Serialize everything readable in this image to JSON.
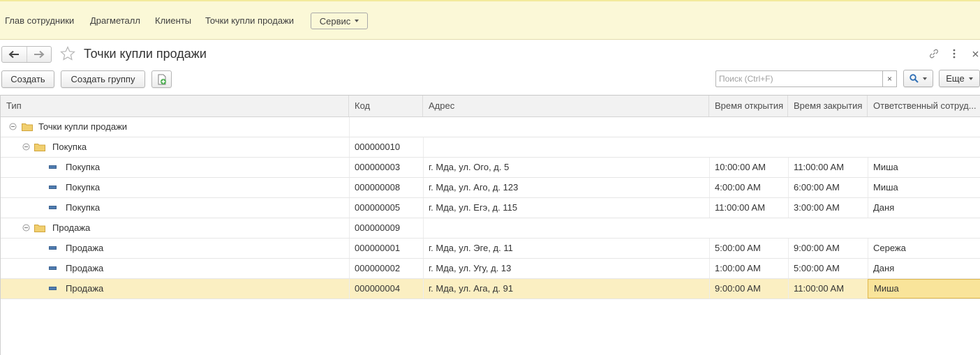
{
  "nav": {
    "items": [
      "Глав сотрудники",
      "Драгметалл",
      "Клиенты",
      "Точки купли продажи"
    ],
    "service_label": "Сервис"
  },
  "page": {
    "title": "Точки купли продажи"
  },
  "toolbar": {
    "create_label": "Создать",
    "create_group_label": "Создать группу",
    "search_placeholder": "Поиск (Ctrl+F)",
    "clear_label": "×",
    "more_label": "Еще"
  },
  "table": {
    "headers": {
      "type": "Тип",
      "code": "Код",
      "address": "Адрес",
      "open": "Время открытия",
      "close": "Время закрытия",
      "responsible": "Ответственный сотруд..."
    },
    "rows": [
      {
        "name": "Точки купли продажи",
        "code": "",
        "address": "",
        "open": "",
        "close": "",
        "resp": ""
      },
      {
        "name": "Покупка",
        "code": "000000010",
        "address": "",
        "open": "",
        "close": "",
        "resp": ""
      },
      {
        "name": "Покупка",
        "code": "000000003",
        "address": "г. Мда, ул. Ого, д. 5",
        "open": "10:00:00 AM",
        "close": "11:00:00 AM",
        "resp": "Миша"
      },
      {
        "name": "Покупка",
        "code": "000000008",
        "address": "г. Мда, ул. Аго, д. 123",
        "open": "4:00:00 AM",
        "close": "6:00:00 AM",
        "resp": "Миша"
      },
      {
        "name": "Покупка",
        "code": "000000005",
        "address": "г. Мда, ул. Егэ, д. 115",
        "open": "11:00:00 AM",
        "close": "3:00:00 AM",
        "resp": "Даня"
      },
      {
        "name": "Продажа",
        "code": "000000009",
        "address": "",
        "open": "",
        "close": "",
        "resp": ""
      },
      {
        "name": "Продажа",
        "code": "000000001",
        "address": "г. Мда, ул. Эге, д. 11",
        "open": "5:00:00 AM",
        "close": "9:00:00 AM",
        "resp": "Сережа"
      },
      {
        "name": "Продажа",
        "code": "000000002",
        "address": "г. Мда, ул. Угу, д. 13",
        "open": "1:00:00 AM",
        "close": "5:00:00 AM",
        "resp": "Даня"
      },
      {
        "name": "Продажа",
        "code": "000000004",
        "address": "г. Мда, ул. Ага, д. 91",
        "open": "9:00:00 AM",
        "close": "11:00:00 AM",
        "resp": "Миша"
      }
    ]
  },
  "colors": {
    "nav_bg": "#fbf8d7",
    "selected_row": "#fbefc2",
    "current_cell": "#f9e49a",
    "folder": "#f1cf6f",
    "item_icon": "#4f7cb0",
    "search_icon": "#2f6fb5"
  }
}
